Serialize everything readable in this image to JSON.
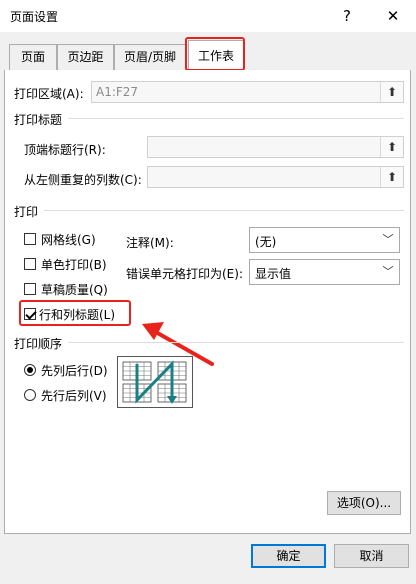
{
  "window": {
    "title": "页面设置",
    "help": "?",
    "close": "✕"
  },
  "tabs": [
    {
      "label": "页面"
    },
    {
      "label": "页边距"
    },
    {
      "label": "页眉/页脚"
    },
    {
      "label": "工作表"
    }
  ],
  "print_area": {
    "label": "打印区域(A):",
    "value": "A1:F27"
  },
  "print_titles": {
    "heading": "打印标题",
    "rows_label": "顶端标题行(R):",
    "cols_label": "从左侧重复的列数(C):"
  },
  "print": {
    "heading": "打印",
    "checkboxes": [
      {
        "label": "网格线(G)",
        "checked": false
      },
      {
        "label": "单色打印(B)",
        "checked": false
      },
      {
        "label": "草稿质量(Q)",
        "checked": false
      },
      {
        "label": "行和列标题(L)",
        "checked": true
      }
    ],
    "comments_label": "注释(M):",
    "comments_value": "(无)",
    "errors_label": "错误单元格打印为(E):",
    "errors_value": "显示值"
  },
  "page_order": {
    "heading": "打印顺序",
    "options": [
      {
        "label": "先列后行(D)",
        "selected": true
      },
      {
        "label": "先行后列(V)",
        "selected": false
      }
    ]
  },
  "buttons": {
    "options": "选项(O)...",
    "ok": "确定",
    "cancel": "取消"
  },
  "colors": {
    "highlight": "#e8231c",
    "accent": "#0078d7",
    "arrow": "#1b7f86"
  },
  "icons": {
    "ref": "collapse-dialog-icon",
    "dropdown": "chevron-down-icon"
  }
}
